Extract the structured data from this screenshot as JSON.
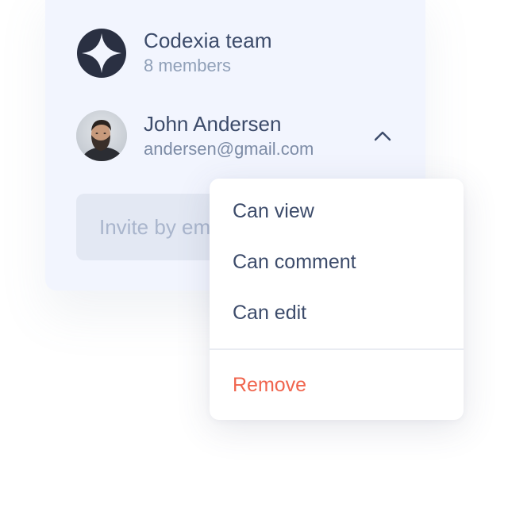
{
  "team": {
    "name": "Codexia team",
    "members_label": "8 members",
    "logo_icon": "four-point-star-logo"
  },
  "member": {
    "name": "John Andersen",
    "email": "andersen@gmail.com",
    "avatar": "bearded-man-portrait",
    "toggle_icon": "chevron-up-icon"
  },
  "invite": {
    "placeholder": "Invite by email"
  },
  "permission_menu": {
    "items": [
      {
        "label": "Can view"
      },
      {
        "label": "Can comment"
      },
      {
        "label": "Can edit"
      }
    ],
    "remove_label": "Remove"
  },
  "colors": {
    "card_background": "#f2f5fe",
    "primary_text": "#3c4b6a",
    "muted_text": "#90a0b8",
    "danger": "#f0654e",
    "logo": "#2a3042"
  }
}
